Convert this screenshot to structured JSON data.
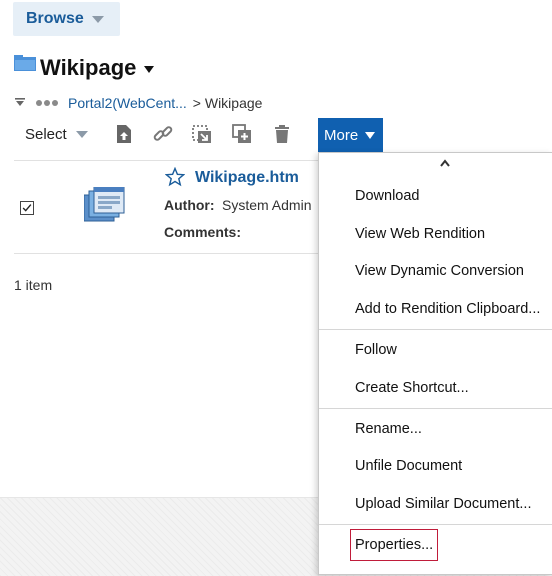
{
  "browse": {
    "label": "Browse"
  },
  "header": {
    "title": "Wikipage"
  },
  "breadcrumb": {
    "parent": "Portal2(WebCent...",
    "current": "> Wikipage"
  },
  "toolbar": {
    "select_label": "Select",
    "more_label": "More"
  },
  "document": {
    "name": "Wikipage.htm",
    "author_label": "Author:",
    "author_value": "System Admin",
    "comments_label": "Comments:",
    "checked": true
  },
  "footer": {
    "item_count": "1 item"
  },
  "menu": {
    "items": [
      "Download",
      "View Web Rendition",
      "View Dynamic Conversion",
      "Add to Rendition Clipboard...",
      "Follow",
      "Create Shortcut...",
      "Rename...",
      "Unfile Document",
      "Upload Similar Document...",
      "Properties..."
    ],
    "highlighted": "Properties..."
  },
  "colors": {
    "accent": "#1060b0",
    "link": "#1a5c9a",
    "highlight_border": "#c01c3a",
    "browse_bg": "#e6eff7"
  },
  "icons": [
    "chevron-down-icon",
    "folder-icon",
    "collapse-icon",
    "ellipsis-icon",
    "upload-version-icon",
    "link-icon",
    "move-icon",
    "copy-icon",
    "trash-icon",
    "chevron-up-icon",
    "star-icon",
    "document-thumbnail-icon",
    "checkbox-checked-icon"
  ]
}
